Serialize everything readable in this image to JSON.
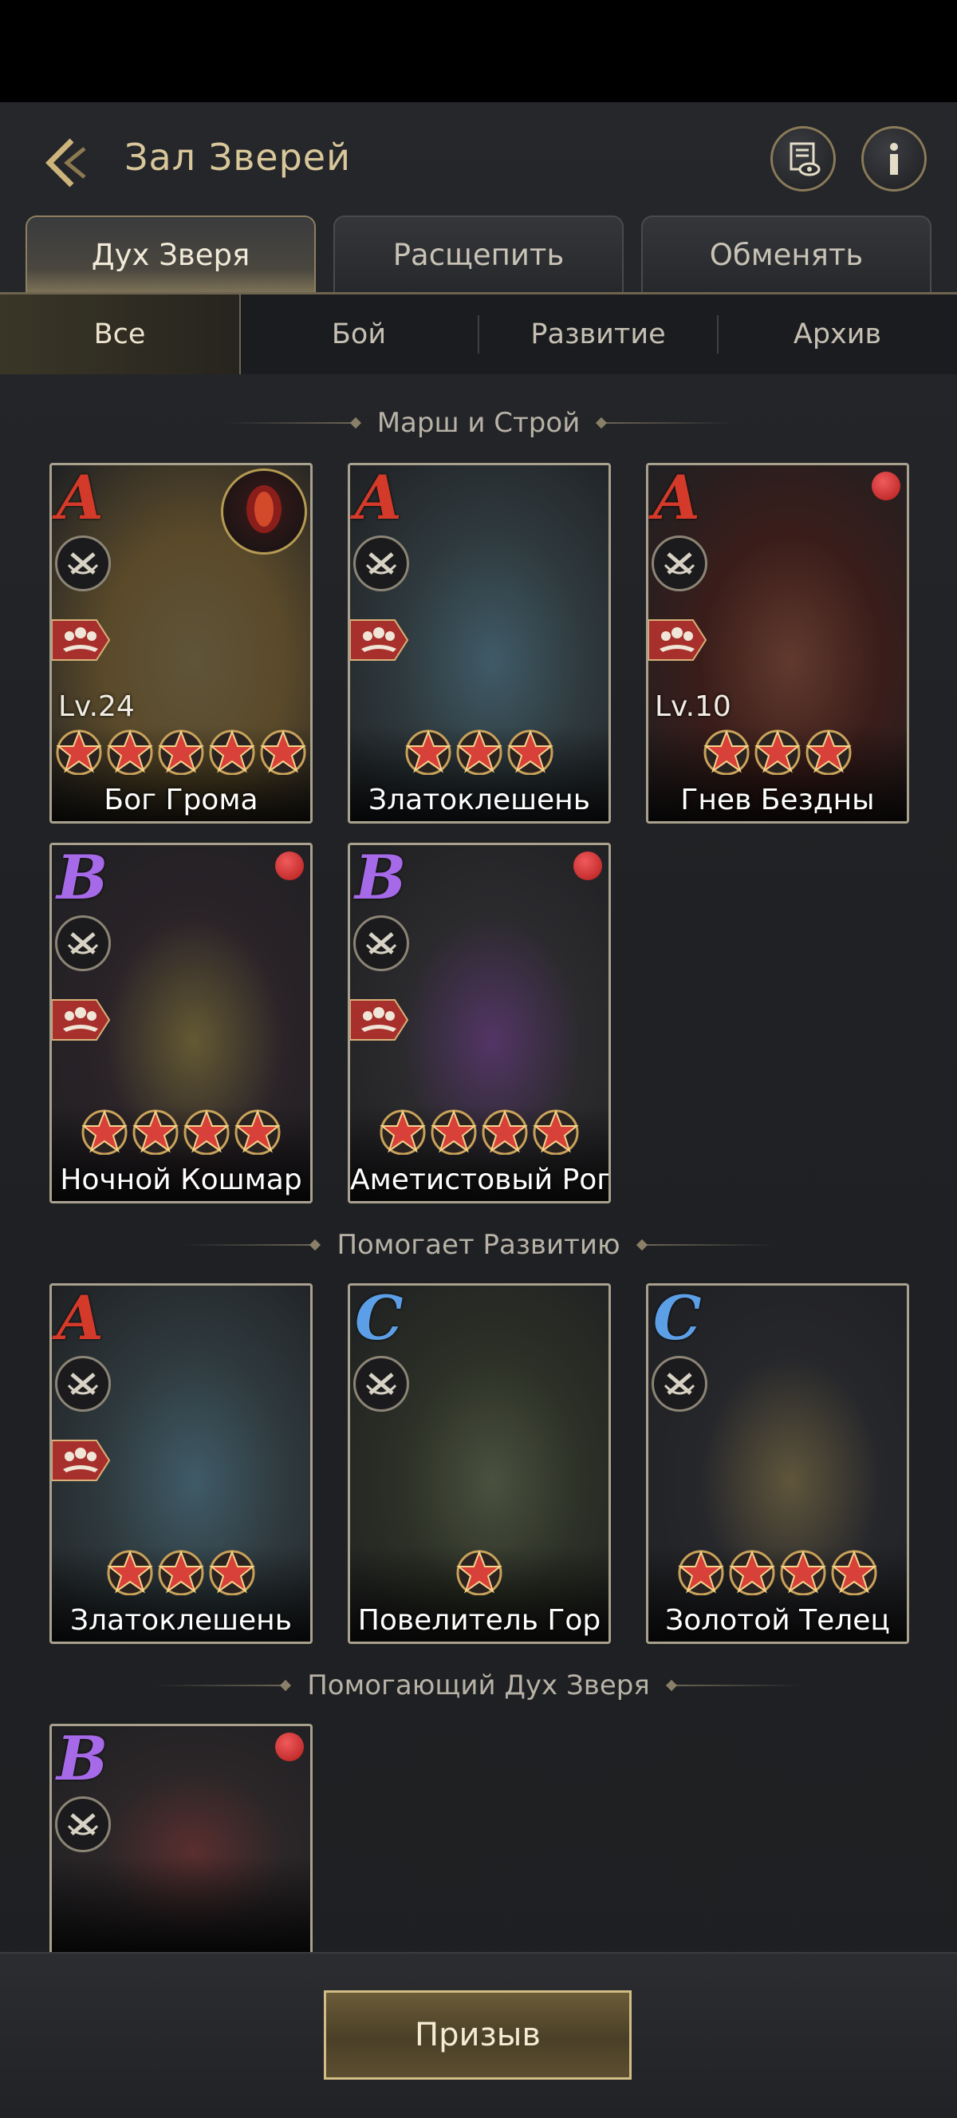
{
  "header": {
    "title": "Зал Зверей"
  },
  "tabs": [
    "Дух Зверя",
    "Расщепить",
    "Обменять"
  ],
  "subtabs": [
    "Все",
    "Бой",
    "Развитие",
    "Архив"
  ],
  "sections": {
    "march": "Марш и Строй",
    "development": "Помогает Развитию",
    "helper": "Помогающий Дух Зверя"
  },
  "cards": [
    {
      "grade": "A",
      "level": "Lv.24",
      "stars": 5,
      "name": "Бог Грома",
      "red_dot": false,
      "art": "thunder-god-icon"
    },
    {
      "grade": "A",
      "level": "",
      "stars": 3,
      "name": "Златоклешень",
      "red_dot": false,
      "art": "crystal-turtle-icon"
    },
    {
      "grade": "A",
      "level": "Lv.10",
      "stars": 3,
      "name": "Гнев Бездны",
      "red_dot": true,
      "art": "dragon-icon"
    },
    {
      "grade": "B",
      "level": "",
      "stars": 4,
      "name": "Ночной Кошмар",
      "red_dot": true,
      "art": "nightmare-horse-icon"
    },
    {
      "grade": "B",
      "level": "",
      "stars": 4,
      "name": "Аметистовый Рог",
      "red_dot": true,
      "art": "amethyst-rhino-icon"
    },
    {
      "grade": "A",
      "level": "",
      "stars": 3,
      "name": "Златоклешень",
      "red_dot": false,
      "art": "crystal-turtle-icon"
    },
    {
      "grade": "C",
      "level": "",
      "stars": 1,
      "name": "Повелитель Гор",
      "red_dot": false,
      "art": "mountain-turtle-icon"
    },
    {
      "grade": "C",
      "level": "",
      "stars": 4,
      "name": "Золотой Телец",
      "red_dot": false,
      "art": "golden-bull-icon"
    },
    {
      "grade": "B",
      "level": "",
      "stars": 0,
      "name": "",
      "red_dot": true,
      "art": "cobra-icon"
    }
  ],
  "bottom": {
    "summon_label": "Призыв"
  },
  "colors": {
    "gold": "#d9c79a",
    "grade_a": "#d33a2a",
    "grade_b": "#a66ae8",
    "grade_c": "#5c9fe6",
    "red_dot": "#d23030"
  }
}
